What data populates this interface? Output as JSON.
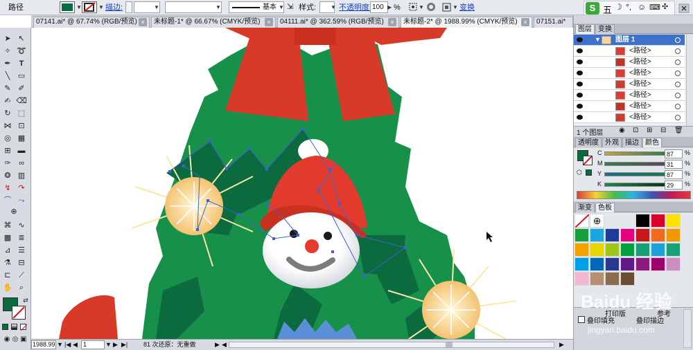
{
  "control_bar": {
    "selection_label": "路径",
    "fill_color": "#0b6a3e",
    "stroke_label": "描边:",
    "stroke_style": "基本",
    "style_label": "样式:",
    "opacity_label": "不透明度:",
    "opacity_value": "100",
    "opacity_unit": "%",
    "transform_label": "变换"
  },
  "doc_tabs": [
    {
      "label": "07141.ai* @ 67.74% (RGB/预览)",
      "active": false
    },
    {
      "label": "未标题-1* @ 66.67% (CMYK/预览)",
      "active": false
    },
    {
      "label": "04111.ai* @ 362.59% (RGB/预览)",
      "active": false
    },
    {
      "label": "未标题-2* @ 1988.99% (CMYK/预览)",
      "active": true
    },
    {
      "label": "07151.ai*",
      "active": false
    }
  ],
  "status_bar": {
    "zoom": "1988.99",
    "page": "1",
    "message": "81 次还原：无重做"
  },
  "ime_bar": {
    "label": "五"
  },
  "layers_panel": {
    "tabs": [
      "图层",
      "变换"
    ],
    "layer_name": "图层 1",
    "sublayers": [
      "<路径>",
      "<路径>",
      "<路径>",
      "<路径>",
      "<路径>",
      "<路径>",
      "<路径>"
    ],
    "footer": "1 个图层"
  },
  "color_panel": {
    "tabs": [
      "透明度",
      "外观",
      "描边",
      "颜色"
    ],
    "fill_color": "#0b6a3e",
    "channels": [
      {
        "label": "C",
        "value": "87"
      },
      {
        "label": "M",
        "value": "31"
      },
      {
        "label": "Y",
        "value": "87"
      },
      {
        "label": "K",
        "value": "29"
      }
    ]
  },
  "swatches_panel": {
    "tabs": [
      "渐变",
      "色板"
    ],
    "colors": [
      "#ffffff",
      "#ffffff",
      "#000000",
      "#d8002c",
      "#ffe100",
      "#169e3a",
      "#1aa6e0",
      "#1e3b95",
      "#e4007f",
      "#c8161d",
      "#ee6b1c",
      "#f19700",
      "#f5a200",
      "#e9d600",
      "#a1c519",
      "#00a13c",
      "#159e77",
      "#1ea0d8",
      "#1aa179",
      "#00a0e9",
      "#0068b7",
      "#283890",
      "#601986",
      "#8d1b7f",
      "#a0006b",
      "#cb8ec0",
      "#f2b6ce",
      "#b48f70",
      "#8a6c4f",
      "#6a4d35"
    ],
    "print_label": "打印版",
    "checkbox_label": "叠印填充",
    "checkbox2_label": "叠印描边",
    "ref_label": "参考"
  },
  "watermark": {
    "text": "Baidu 经验",
    "subtext": "jingyan.baidu.com"
  }
}
